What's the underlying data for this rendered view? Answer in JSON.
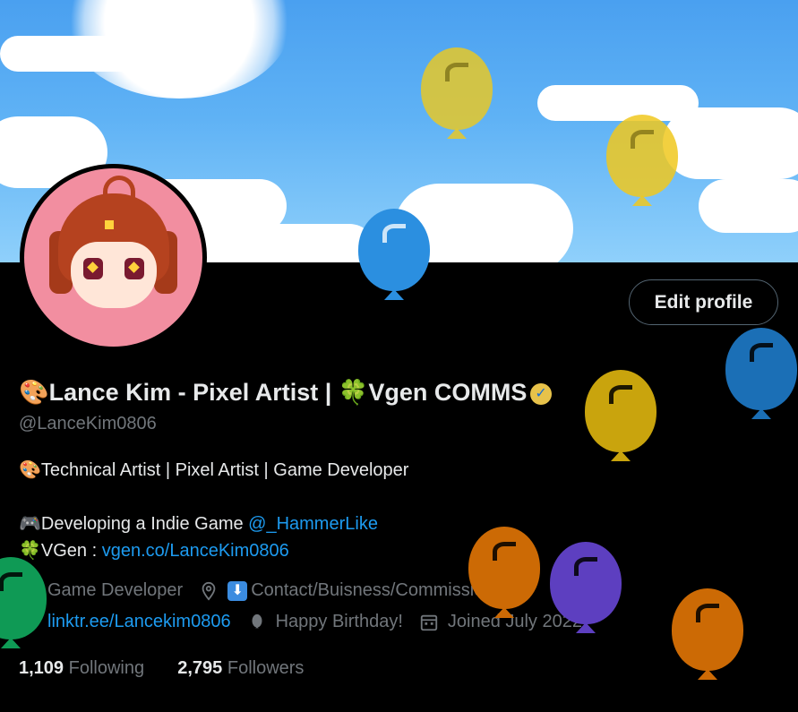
{
  "profile": {
    "name_emoji_1": "🎨",
    "name_text": "Lance Kim - Pixel Artist | ",
    "name_emoji_2": "🍀",
    "name_text_2": "Vgen COMMS",
    "handle": "@LanceKim0806",
    "edit_profile_label": "Edit profile"
  },
  "bio": {
    "line1_emoji": "🎨",
    "line1_text": "Technical Artist | Pixel Artist | Game Developer",
    "line2_emoji": "🎮",
    "line2_text": "Developing a Indie Game ",
    "line2_mention": "@_HammerLike",
    "line3_emoji": "🍀",
    "line3_text": "VGen : ",
    "line3_link": "vgen.co/LanceKim0806"
  },
  "meta": {
    "profession": "Game Developer",
    "location": "Contact/Buisness/Commission",
    "website": "linktr.ee/Lancekim0806",
    "birthday": "Happy Birthday!",
    "joined": "Joined July 2022"
  },
  "stats": {
    "following_count": "1,109",
    "following_label": "Following",
    "followers_count": "2,795",
    "followers_label": "Followers"
  },
  "colors": {
    "accent": "#1d9bf0",
    "muted": "#71767b",
    "text": "#e7e9ea",
    "background": "#000000"
  }
}
